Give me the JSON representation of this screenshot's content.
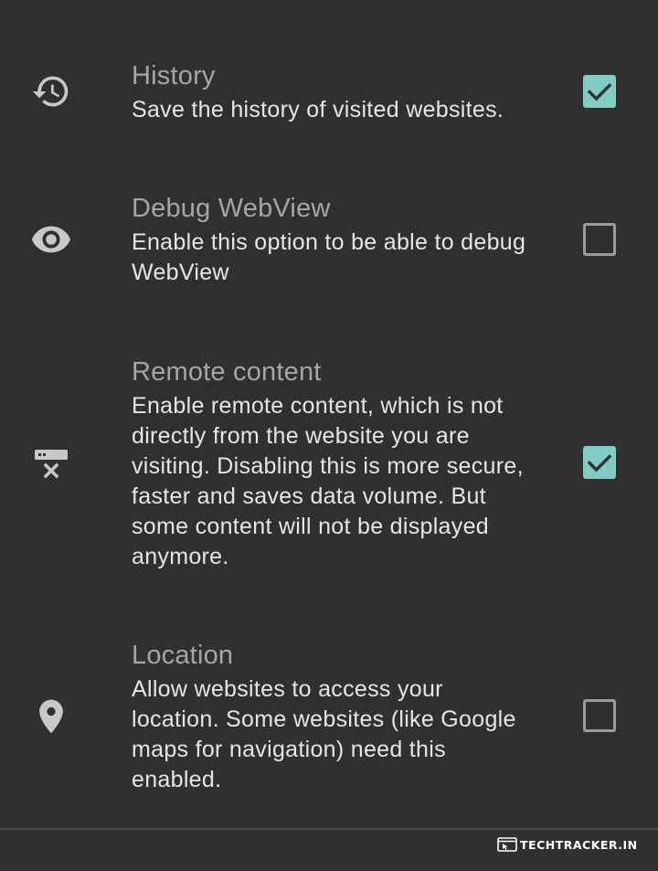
{
  "settings": [
    {
      "id": "history",
      "icon": "history-icon",
      "title": "History",
      "summary": "Save the history of visited websites.",
      "checked": true
    },
    {
      "id": "debug-webview",
      "icon": "eye-icon",
      "title": "Debug WebView",
      "summary": "Enable this option to be able to debug WebView",
      "checked": false
    },
    {
      "id": "remote-content",
      "icon": "remote-content-blocked-icon",
      "title": "Remote content",
      "summary": "Enable remote content, which is not directly from the website you are visiting. Disabling this is more secure, faster and saves data volume. But some content will not be displayed anymore.",
      "checked": true
    },
    {
      "id": "location",
      "icon": "location-pin-icon",
      "title": "Location",
      "summary": "Allow websites to access your location. Some websites (like Google maps for navigation) need this enabled.",
      "checked": false
    }
  ],
  "watermark": {
    "text": "TECHTRACKER.IN"
  },
  "colors": {
    "background": "#303030",
    "accent": "#80cbc4",
    "title": "#a6a6a6",
    "summary": "#e6e6e6",
    "icon": "#c8c8c8",
    "checkbox_border": "#9b9b9b"
  }
}
